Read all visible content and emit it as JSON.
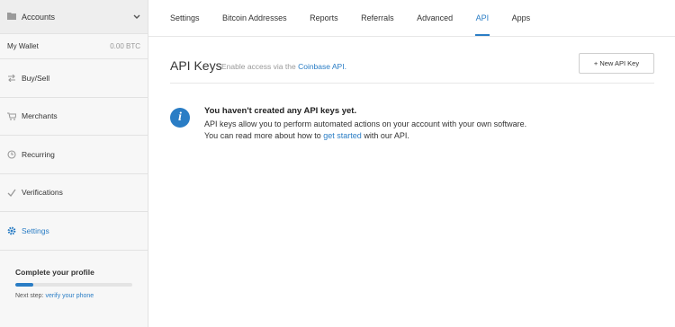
{
  "sidebar": {
    "accounts_label": "Accounts",
    "wallet": {
      "name": "My Wallet",
      "balance": "0.00 BTC"
    },
    "items": [
      {
        "label": "Buy/Sell",
        "icon": "exchange-icon"
      },
      {
        "label": "Merchants",
        "icon": "cart-icon"
      },
      {
        "label": "Recurring",
        "icon": "clock-icon"
      },
      {
        "label": "Verifications",
        "icon": "check-icon"
      },
      {
        "label": "Settings",
        "icon": "gear-icon",
        "active": true
      }
    ],
    "profile": {
      "title": "Complete your profile",
      "progress_percent": 15,
      "next_step_prefix": "Next step:",
      "next_step_link": "verify your phone"
    }
  },
  "tabs": [
    {
      "label": "Settings"
    },
    {
      "label": "Bitcoin Addresses"
    },
    {
      "label": "Reports"
    },
    {
      "label": "Referrals"
    },
    {
      "label": "Advanced"
    },
    {
      "label": "API",
      "active": true
    },
    {
      "label": "Apps"
    }
  ],
  "page": {
    "title": "API Keys",
    "subtitle_prefix": "Enable access via the",
    "subtitle_link": "Coinbase API.",
    "new_key_button": "+ New API Key"
  },
  "info": {
    "heading": "You haven't created any API keys yet.",
    "line1": "API keys allow you to perform automated actions on your account with your own software.",
    "line2_prefix": "You can read more about how to",
    "line2_link": "get started",
    "line2_suffix": "with our API."
  },
  "colors": {
    "accent": "#2a7dc5",
    "sidebar_bg": "#f7f7f7",
    "border": "#e2e2e2"
  }
}
